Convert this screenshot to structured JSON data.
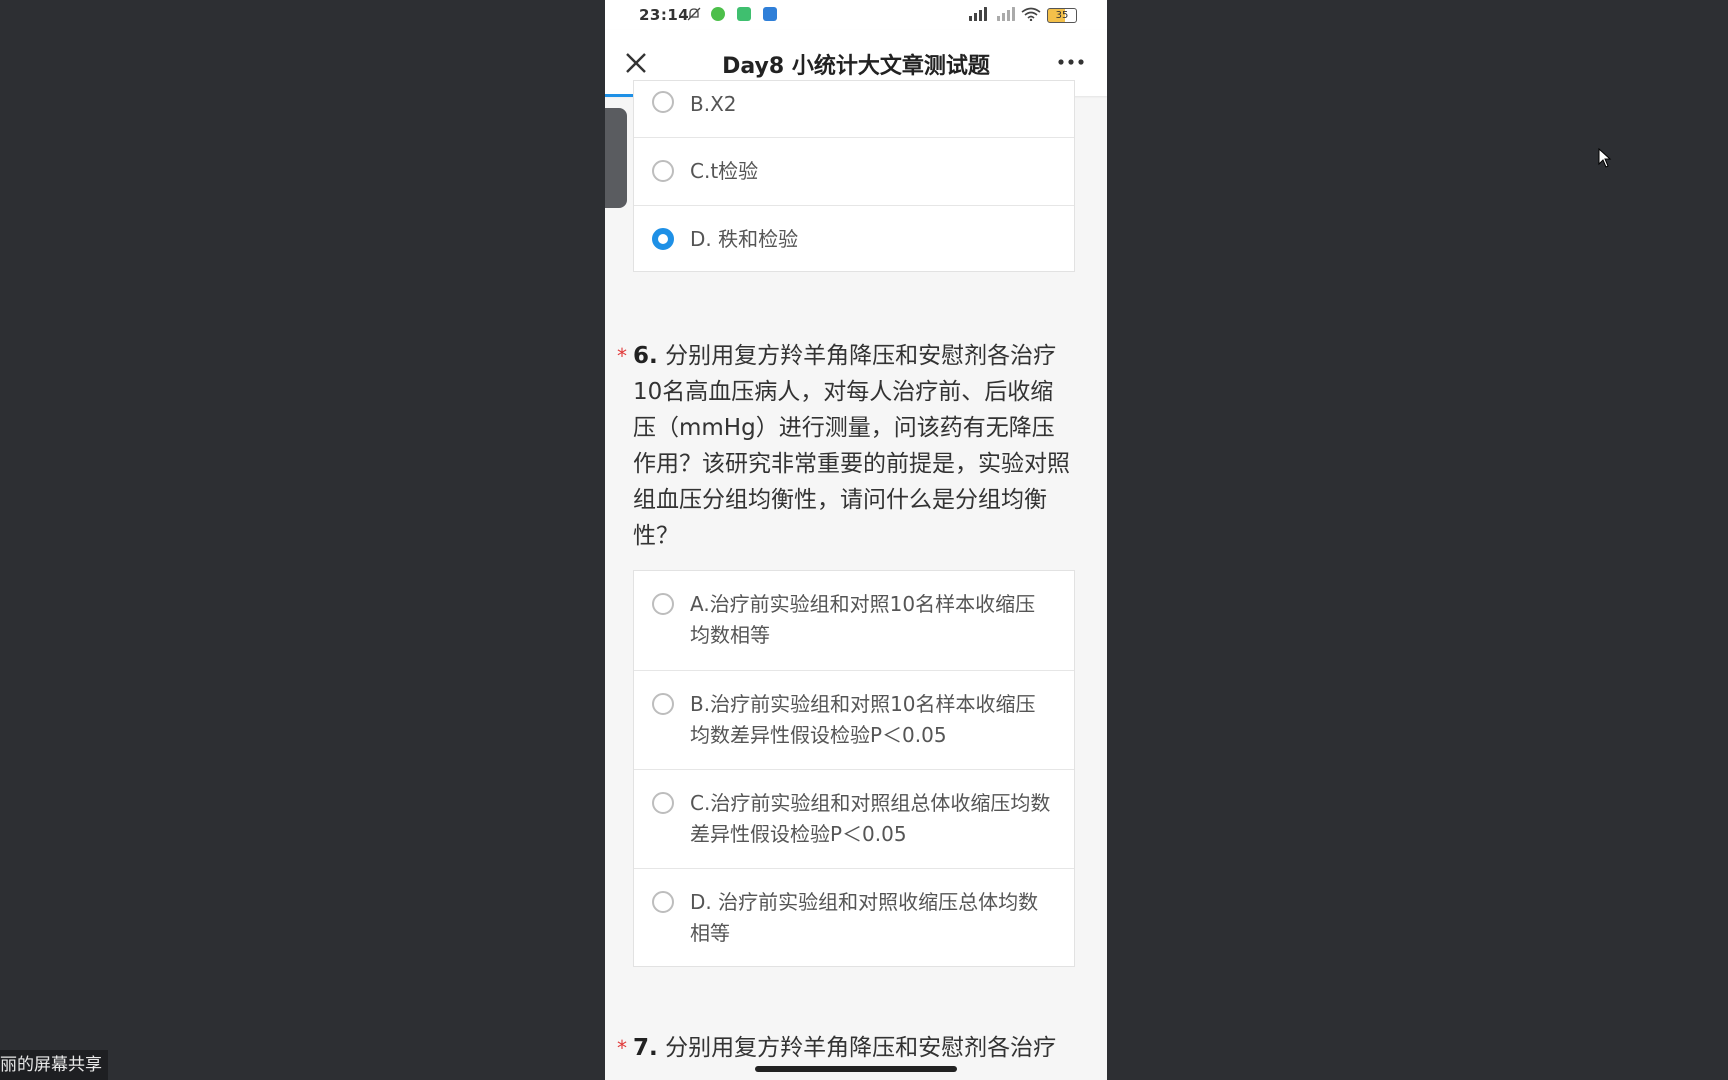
{
  "screen_share_label": "丽的屏幕共享",
  "status_bar": {
    "time": "23:14",
    "battery": "35",
    "icons": [
      "mute-bell-icon",
      "app-green-icon",
      "app-green-square-icon",
      "app-blue-icon",
      "signal-icon",
      "signal-weak-icon",
      "wifi-icon",
      "battery-icon"
    ]
  },
  "nav": {
    "title": "Day8 小统计大文章测试题",
    "close_icon": "close-icon",
    "more_icon": "more-icon"
  },
  "q5_options": [
    {
      "label": "B.X2",
      "checked": false
    },
    {
      "label": "C.t检验",
      "checked": false
    },
    {
      "label": "D. 秩和检验",
      "checked": true
    }
  ],
  "q6": {
    "star": "*",
    "number": "6.",
    "text": "分别用复方羚羊角降压和安慰剂各治疗10名高血压病人，对每人治疗前、后收缩压（mmHg）进行测量，问该药有无降压作用？该研究非常重要的前提是，实验对照组血压分组均衡性，请问什么是分组均衡性？",
    "options": [
      {
        "label": "A.治疗前实验组和对照10名样本收缩压均数相等",
        "checked": false
      },
      {
        "label": "B.治疗前实验组和对照10名样本收缩压均数差异性假设检验P＜0.05",
        "checked": false
      },
      {
        "label": "C.治疗前实验组和对照组总体收缩压均数差异性假设检验P＜0.05",
        "checked": false
      },
      {
        "label": "D. 治疗前实验组和对照收缩压总体均数相等",
        "checked": false
      }
    ]
  },
  "q7": {
    "star": "*",
    "number": "7.",
    "text": "分别用复方羚羊角降压和安慰剂各治疗"
  },
  "colors": {
    "accent": "#1e90e6",
    "required_star": "#e03a3a"
  }
}
